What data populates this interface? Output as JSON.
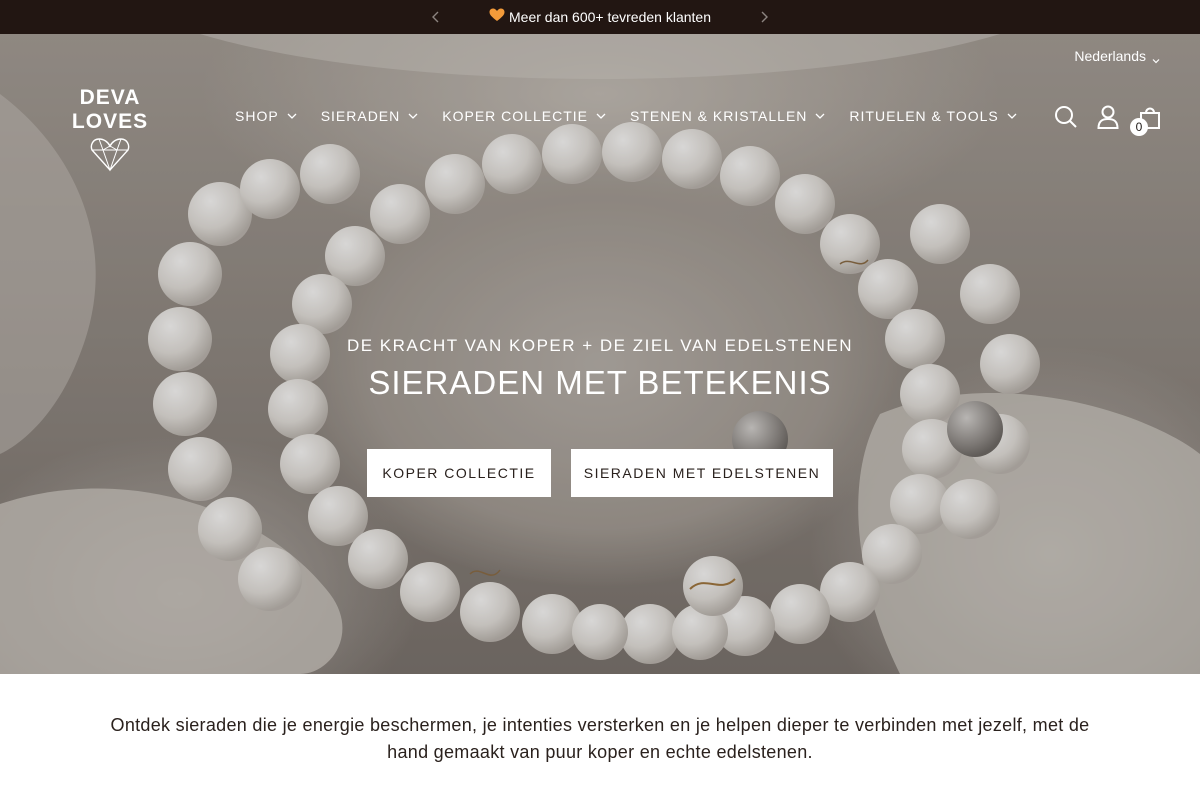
{
  "announcement": {
    "text": "Meer dan 600+ tevreden klanten",
    "heart_icon": "orange-heart-icon"
  },
  "header": {
    "language": "Nederlands",
    "logo_text": "DEVA LOVES",
    "nav": [
      {
        "label": "SHOP"
      },
      {
        "label": "SIERADEN"
      },
      {
        "label": "KOPER COLLECTIE"
      },
      {
        "label": "STENEN & KRISTALLEN"
      },
      {
        "label": "RITUELEN & TOOLS"
      }
    ],
    "cart_count": "0"
  },
  "hero": {
    "subtitle": "DE KRACHT VAN KOPER + DE ZIEL VAN EDELSTENEN",
    "title": "SIERADEN MET BETEKENIS",
    "button_1": "KOPER COLLECTIE",
    "button_2": "SIERADEN MET EDELSTENEN"
  },
  "intro": {
    "text": "Ontdek sieraden die je energie beschermen, je intenties versterken en je helpen dieper te verbinden met jezelf, met de hand gemaakt van puur koper en echte edelstenen."
  },
  "colors": {
    "announcement_bg": "#221612",
    "accent_heart": "#f39b3a",
    "button_bg": "#ffffff",
    "text_dark": "#2a211d"
  }
}
